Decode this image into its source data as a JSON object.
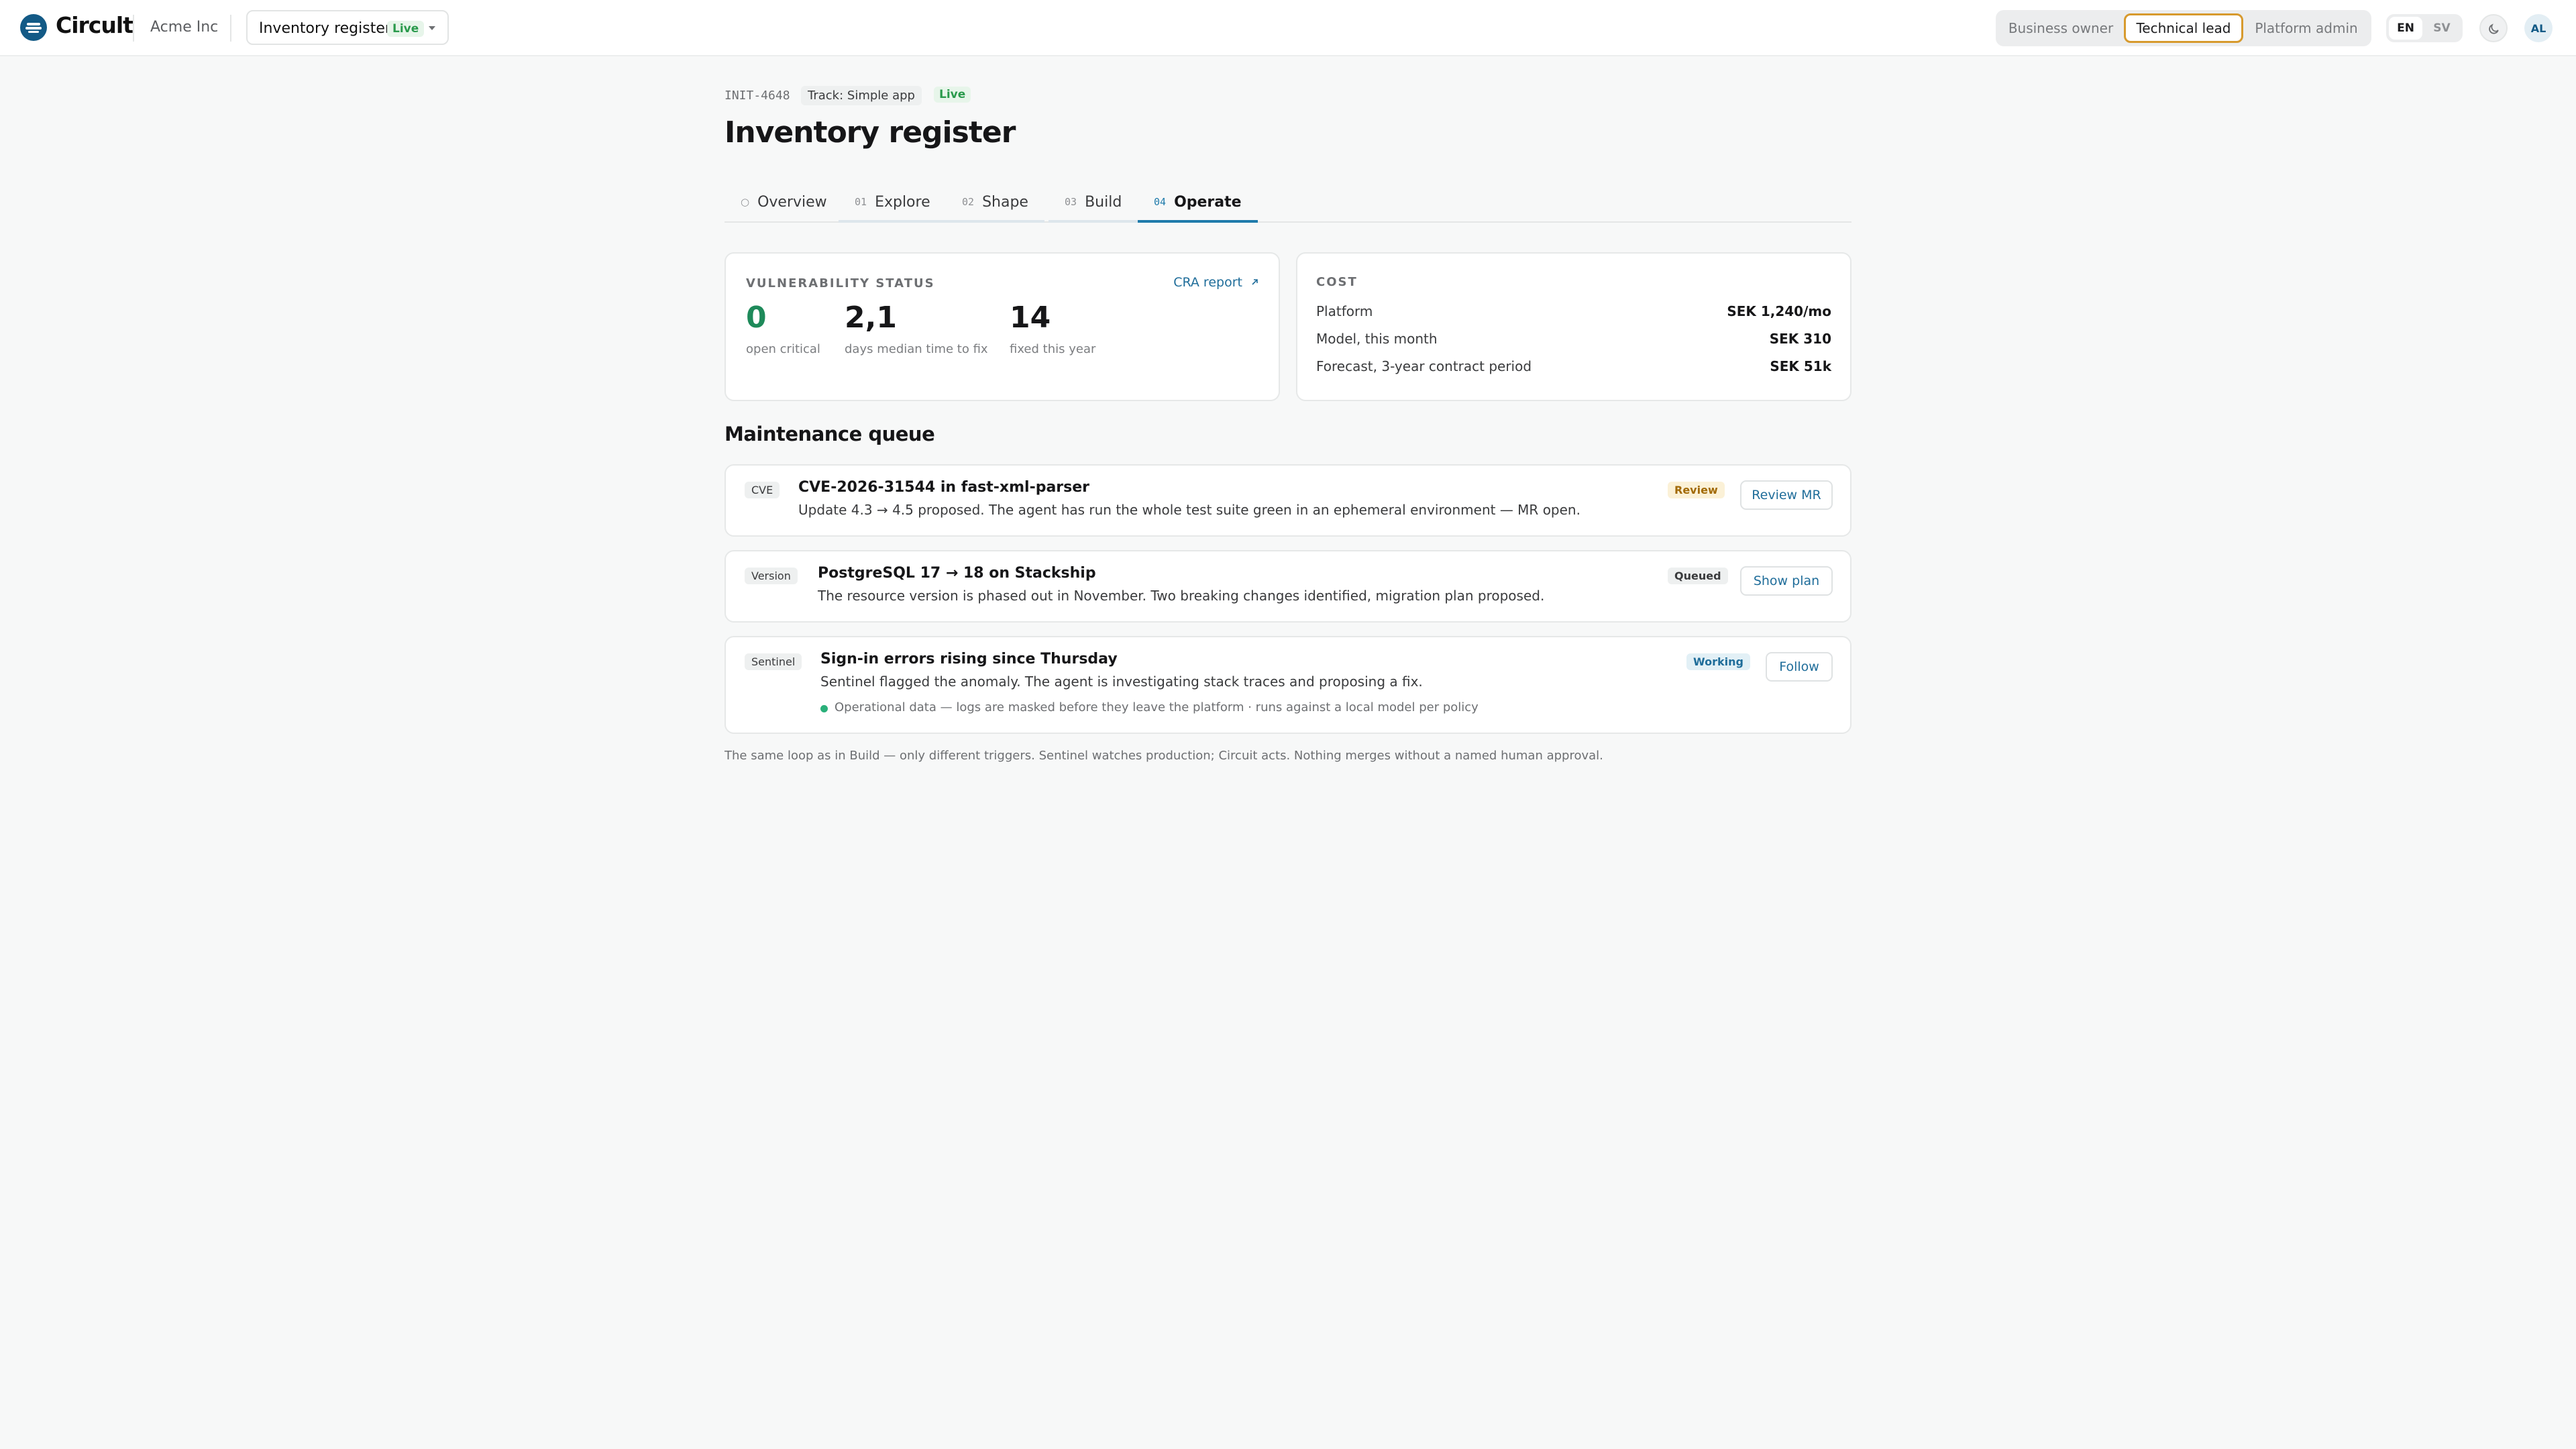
{
  "app": {
    "name": "Circult",
    "org": "Acme Inc"
  },
  "project": {
    "name": "Inventory register",
    "status": "Live"
  },
  "roles": [
    {
      "label": "Business owner",
      "active": false
    },
    {
      "label": "Technical lead",
      "active": true
    },
    {
      "label": "Platform admin",
      "active": false
    }
  ],
  "languages": [
    {
      "label": "EN",
      "active": true
    },
    {
      "label": "SV",
      "active": false
    }
  ],
  "user": {
    "initials": "AL"
  },
  "icons": [
    "logo-icon",
    "chevron-down-icon",
    "moon-icon",
    "external-link-icon",
    "status-dot-icon"
  ],
  "page": {
    "id": "INIT-4648",
    "track": "Track: Simple app",
    "status": "Live",
    "title": "Inventory register"
  },
  "tabs": [
    {
      "num": "○",
      "label": "Overview",
      "active": false
    },
    {
      "num": "01",
      "label": "Explore",
      "active": false
    },
    {
      "num": "02",
      "label": "Shape",
      "active": false
    },
    {
      "num": "03",
      "label": "Build",
      "active": false
    },
    {
      "num": "04",
      "label": "Operate",
      "active": true
    }
  ],
  "vulnerability": {
    "label": "VULNERABILITY STATUS",
    "link": "CRA report",
    "stats": [
      {
        "value": "0",
        "caption": "open critical"
      },
      {
        "value": "2,1",
        "caption": "days median time to fix"
      },
      {
        "value": "14",
        "caption": "fixed this year"
      }
    ]
  },
  "cost": {
    "label": "COST",
    "rows": [
      {
        "key": "Platform",
        "value": "SEK 1,240/mo"
      },
      {
        "key": "Model, this month",
        "value": "SEK 310"
      },
      {
        "key": "Forecast, 3-year contract period",
        "value": "SEK 51k"
      }
    ]
  },
  "queue": {
    "title": "Maintenance queue",
    "items": [
      {
        "tag": "CVE",
        "title": "CVE-2026-31544 in fast-xml-parser",
        "desc": "Update 4.3 → 4.5 proposed. The agent has run the whole test suite green in an ephemeral environment — MR open.",
        "status": "Review",
        "action": "Review MR"
      },
      {
        "tag": "Version",
        "title": "PostgreSQL 17 → 18 on Stackship",
        "desc": "The resource version is phased out in November. Two breaking changes identified, migration plan proposed.",
        "status": "Queued",
        "action": "Show plan"
      },
      {
        "tag": "Sentinel",
        "title": "Sign-in errors rising since Thursday",
        "desc": "Sentinel flagged the anomaly. The agent is investigating stack traces and proposing a fix.",
        "note": "Operational data — logs are masked before they leave the platform · runs against a local model per policy",
        "status": "Working",
        "action": "Follow"
      }
    ],
    "footnote": "The same loop as in Build — only different triggers. Sentinel watches production; Circuit acts. Nothing merges without a named human approval."
  },
  "colors": {
    "brand": "#135a86",
    "accent": "#1f7bab",
    "live": "#2a9a4c",
    "role_active_border": "#d79a2e",
    "critical_zero": "#1e8a5a"
  }
}
